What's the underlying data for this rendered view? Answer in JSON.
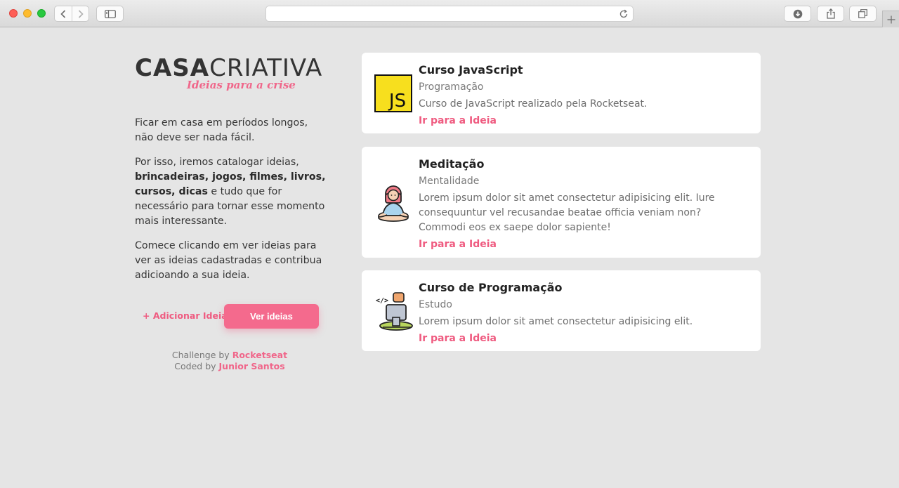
{
  "browser": {
    "url": ""
  },
  "logo": {
    "bold": "CASA",
    "light": "CRIATIVA",
    "tagline": "Ideias para a crise"
  },
  "intro": {
    "p1": "Ficar em casa em períodos longos, não deve ser nada fácil.",
    "p2_start": "Por isso, iremos catalogar ideias, ",
    "p2_bold": "brincadeiras, jogos, filmes, livros, cursos, dicas",
    "p2_end": " e tudo que for necessário para tornar esse momento mais interessante.",
    "p3": "Comece clicando em ver ideias para ver as ideias cadastradas e contribua adicioando a sua ideia."
  },
  "actions": {
    "add_label": "+ Adicionar Ideia",
    "view_label": "Ver ideias"
  },
  "credits": {
    "challenge_prefix": "Challenge by ",
    "challenge_name": "Rocketseat",
    "coded_prefix": "Coded by ",
    "coded_name": "Junior Santos"
  },
  "cards": [
    {
      "icon": "javascript-icon",
      "title": "Curso JavaScript",
      "category": "Programação",
      "description": "Curso de JavaScript realizado pela Rocketseat.",
      "link": "Ir para a Ideia",
      "icon_text": "JS"
    },
    {
      "icon": "meditation-icon",
      "title": "Meditação",
      "category": "Mentalidade",
      "description": "Lorem ipsum dolor sit amet consectetur adipisicing elit. Iure consequuntur vel recusandae beatae officia veniam non? Commodi eos ex saepe dolor sapiente!",
      "link": "Ir para a Ideia"
    },
    {
      "icon": "programmer-icon",
      "title": "Curso de Programação",
      "category": "Estudo",
      "description": "Lorem ipsum dolor sit amet consectetur adipisicing elit.",
      "link": "Ir para a Ideia",
      "icon_text": "</>"
    }
  ],
  "colors": {
    "accent": "#f46a8d",
    "background": "#e5e5e5",
    "card": "#ffffff"
  }
}
